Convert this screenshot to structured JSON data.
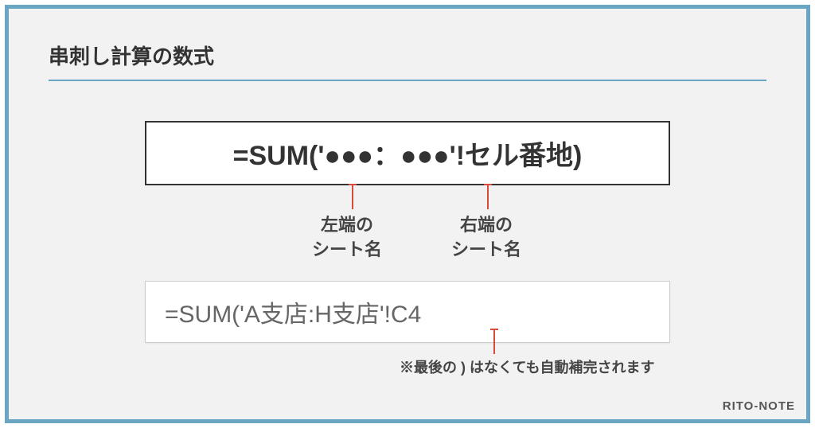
{
  "title": "串刺し計算の数式",
  "formula_template": "=SUM('●●●：●●●'!セル番地)",
  "callouts": {
    "left": "左端の\nシート名",
    "right": "右端の\nシート名"
  },
  "example_formula": "=SUM('A支店:H支店'!C4",
  "example_note": "※最後の ) はなくても自動補完されます",
  "watermark": "RITO-NOTE"
}
